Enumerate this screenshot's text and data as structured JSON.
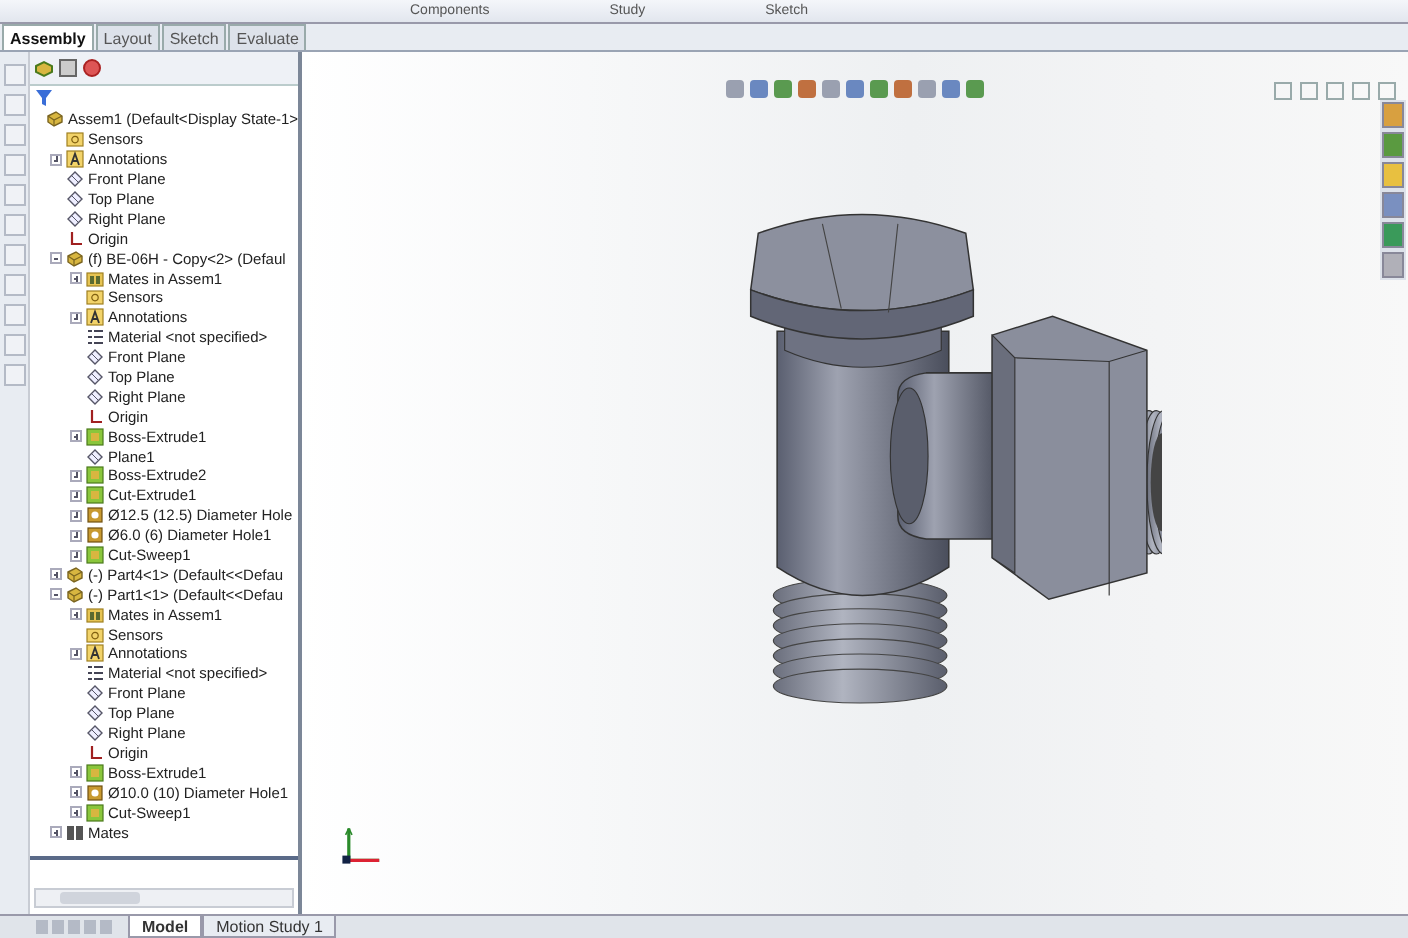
{
  "ribbon": {
    "labels": [
      "Components",
      "Study",
      "Sketch"
    ]
  },
  "command_tabs": [
    {
      "label": "Assembly",
      "selected": true
    },
    {
      "label": "Layout",
      "selected": false
    },
    {
      "label": "Sketch",
      "selected": false
    },
    {
      "label": "Evaluate",
      "selected": false
    }
  ],
  "tree": {
    "label": "Assem1 (Default<Display State-1>",
    "kind": "assembly",
    "children": [
      {
        "label": "Sensors",
        "kind": "folder"
      },
      {
        "label": "Annotations",
        "kind": "annotation",
        "expanded": false
      },
      {
        "label": "Front Plane",
        "kind": "plane"
      },
      {
        "label": "Top Plane",
        "kind": "plane"
      },
      {
        "label": "Right Plane",
        "kind": "plane"
      },
      {
        "label": "Origin",
        "kind": "origin"
      },
      {
        "label": "(f) BE-06H - Copy<2> (Defaul",
        "kind": "part",
        "expanded": true,
        "children": [
          {
            "label": "Mates in Assem1",
            "kind": "mates-folder",
            "expanded": false
          },
          {
            "label": "Sensors",
            "kind": "folder"
          },
          {
            "label": "Annotations",
            "kind": "annotation",
            "expanded": false
          },
          {
            "label": "Material <not specified>",
            "kind": "material"
          },
          {
            "label": "Front Plane",
            "kind": "plane"
          },
          {
            "label": "Top Plane",
            "kind": "plane"
          },
          {
            "label": "Right Plane",
            "kind": "plane"
          },
          {
            "label": "Origin",
            "kind": "origin"
          },
          {
            "label": "Boss-Extrude1",
            "kind": "feature",
            "expanded": false
          },
          {
            "label": "Plane1",
            "kind": "plane"
          },
          {
            "label": "Boss-Extrude2",
            "kind": "feature",
            "expanded": false
          },
          {
            "label": "Cut-Extrude1",
            "kind": "feature",
            "expanded": false
          },
          {
            "label": "Ø12.5 (12.5) Diameter Hole",
            "kind": "hole",
            "expanded": false
          },
          {
            "label": "Ø6.0 (6) Diameter Hole1",
            "kind": "hole",
            "expanded": false
          },
          {
            "label": "Cut-Sweep1",
            "kind": "feature",
            "expanded": false
          }
        ]
      },
      {
        "label": "(-) Part4<1> (Default<<Defau",
        "kind": "part",
        "expanded": false
      },
      {
        "label": "(-) Part1<1> (Default<<Defau",
        "kind": "part",
        "expanded": true,
        "children": [
          {
            "label": "Mates in Assem1",
            "kind": "mates-folder",
            "expanded": false
          },
          {
            "label": "Sensors",
            "kind": "folder"
          },
          {
            "label": "Annotations",
            "kind": "annotation",
            "expanded": false
          },
          {
            "label": "Material <not specified>",
            "kind": "material"
          },
          {
            "label": "Front Plane",
            "kind": "plane"
          },
          {
            "label": "Top Plane",
            "kind": "plane"
          },
          {
            "label": "Right Plane",
            "kind": "plane"
          },
          {
            "label": "Origin",
            "kind": "origin"
          },
          {
            "label": "Boss-Extrude1",
            "kind": "feature",
            "expanded": false
          },
          {
            "label": "Ø10.0 (10) Diameter Hole1",
            "kind": "hole",
            "expanded": false
          },
          {
            "label": "Cut-Sweep1",
            "kind": "feature",
            "expanded": false
          }
        ]
      },
      {
        "label": "Mates",
        "kind": "mates",
        "expanded": false
      }
    ]
  },
  "bottom_tabs": [
    {
      "label": "Model",
      "selected": true
    },
    {
      "label": "Motion Study 1",
      "selected": false
    }
  ]
}
